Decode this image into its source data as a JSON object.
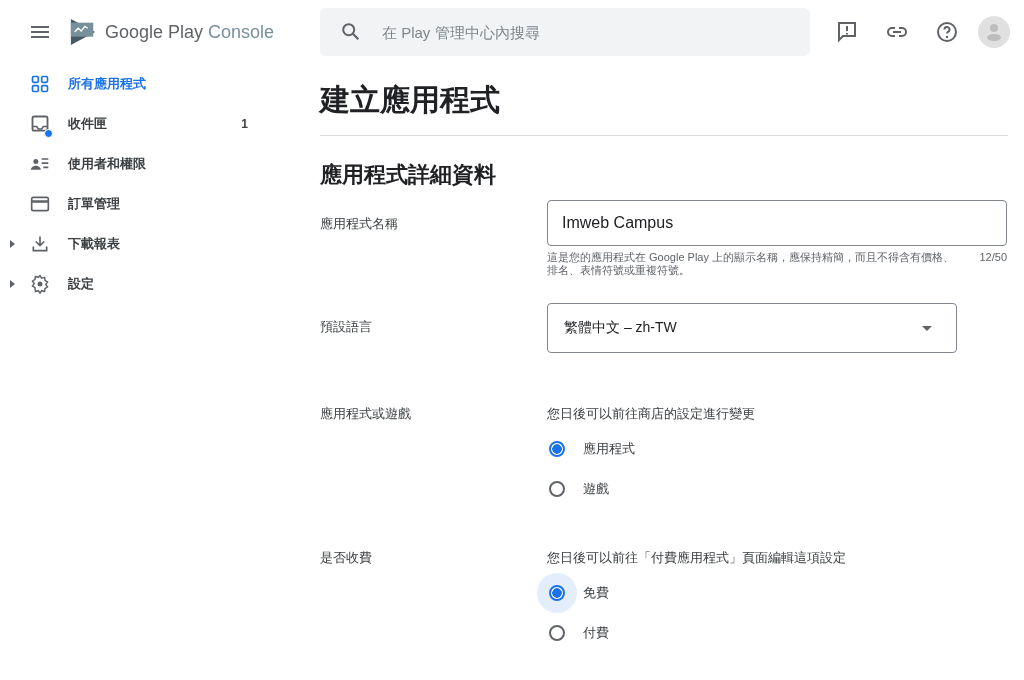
{
  "header": {
    "brand": "Google Play",
    "product": "Console",
    "search": {
      "placeholder": "在 Play 管理中心內搜尋"
    }
  },
  "sidebar": {
    "items": [
      {
        "label": "所有應用程式",
        "selected": true,
        "dot": false
      },
      {
        "label": "收件匣",
        "selected": false,
        "dot": true,
        "count": "1"
      },
      {
        "label": "使用者和權限",
        "selected": false,
        "dot": false
      },
      {
        "label": "訂單管理",
        "selected": false,
        "dot": false
      },
      {
        "label": "下載報表",
        "selected": false,
        "dot": false,
        "expanded": false
      },
      {
        "label": "設定",
        "selected": false,
        "dot": false,
        "expanded": false
      }
    ]
  },
  "page": {
    "title": "建立應用程式",
    "section": "應用程式詳細資料",
    "fields": [
      {
        "kind": "text",
        "label": "應用程式名稱",
        "value": "Imweb Campus",
        "hint": "這是您的應用程式在 Google Play 上的顯示名稱，應保持精簡，而且不得含有價格、排名、表情符號或重複符號。",
        "counter": "12/50"
      },
      {
        "kind": "select",
        "label": "預設語言",
        "value": "繁體中文 – zh-TW"
      },
      {
        "kind": "radio",
        "label": "應用程式或遊戲",
        "note": "您日後可以前往商店的設定進行變更",
        "options": [
          {
            "label": "應用程式",
            "selected": true,
            "focused": false
          },
          {
            "label": "遊戲",
            "selected": false,
            "focused": false
          }
        ]
      },
      {
        "kind": "radio",
        "label": "是否收費",
        "note": "您日後可以前往「付費應用程式」頁面編輯這項設定",
        "options": [
          {
            "label": "免費",
            "selected": true,
            "focused": true
          },
          {
            "label": "付費",
            "selected": false,
            "focused": false
          }
        ]
      }
    ]
  }
}
